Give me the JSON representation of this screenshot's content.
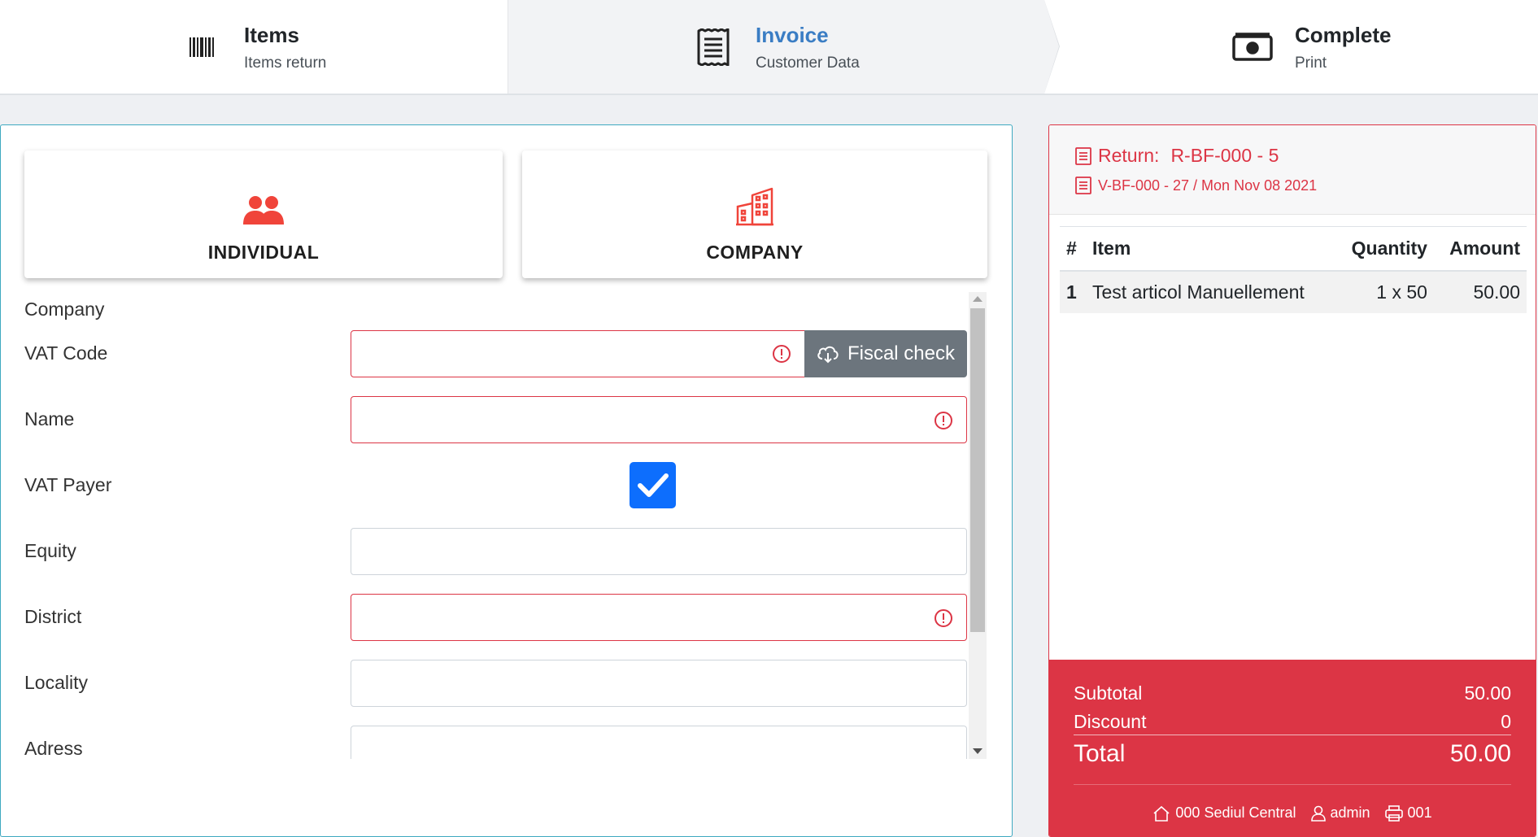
{
  "steps": [
    {
      "title": "Items",
      "subtitle": "Items return",
      "icon": "barcode-icon"
    },
    {
      "title": "Invoice",
      "subtitle": "Customer Data",
      "icon": "receipt-icon",
      "active": true
    },
    {
      "title": "Complete",
      "subtitle": "Print",
      "icon": "money-icon"
    }
  ],
  "customer_types": {
    "individual": {
      "label": "INDIVIDUAL",
      "icon": "users-icon"
    },
    "company": {
      "label": "COMPANY",
      "icon": "building-icon"
    }
  },
  "form": {
    "section": "Company",
    "vat_code": {
      "label": "VAT Code",
      "value": ""
    },
    "fiscal_check": "Fiscal check",
    "name": {
      "label": "Name",
      "value": ""
    },
    "vat_payer": {
      "label": "VAT Payer",
      "checked": true
    },
    "equity": {
      "label": "Equity",
      "value": ""
    },
    "district": {
      "label": "District",
      "value": ""
    },
    "locality": {
      "label": "Locality",
      "value": ""
    },
    "adress": {
      "label": "Adress",
      "value": ""
    }
  },
  "receipt": {
    "return_label": "Return:",
    "return_code": "R-BF-000 - 5",
    "invoice_ref": "V-BF-000 - 27 / Mon Nov 08 2021",
    "columns": [
      "#",
      "Item",
      "Quantity",
      "Amount"
    ],
    "items": [
      {
        "num": "1",
        "item": "Test articol Manuellement",
        "quantity": "1 x 50",
        "amount": "50.00"
      }
    ],
    "subtotal_label": "Subtotal",
    "subtotal": "50.00",
    "discount_label": "Discount",
    "discount": "0",
    "total_label": "Total",
    "total": "50.00",
    "location": "000 Sediul Central",
    "user": "admin",
    "register": "001"
  },
  "colors": {
    "accent": "#3a7dc4",
    "danger": "#dc3545",
    "teal_border": "#3fa9c0",
    "checkbox": "#0d6efd",
    "button_secondary": "#6c757d"
  }
}
